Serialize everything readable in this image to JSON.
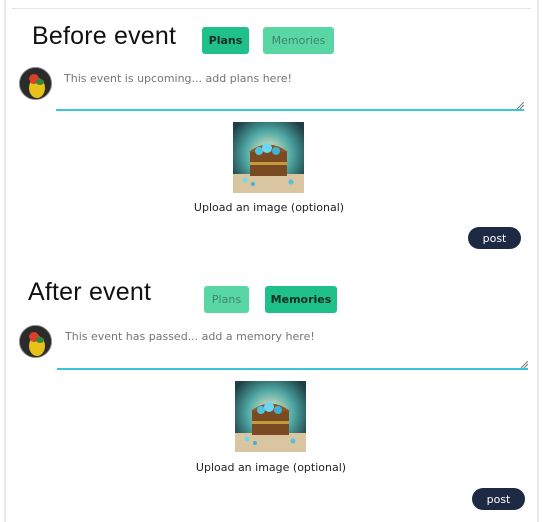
{
  "before": {
    "heading": "Before event",
    "tabs": {
      "plans": "Plans",
      "memories": "Memories",
      "active": "plans"
    },
    "placeholder": "This event is upcoming... add plans here!",
    "upload_label": "Upload an image (optional)",
    "post_label": "post"
  },
  "after": {
    "heading": "After event",
    "tabs": {
      "plans": "Plans",
      "memories": "Memories",
      "active": "memories"
    },
    "placeholder": "This event has passed... add a memory here!",
    "upload_label": "Upload an image (optional)",
    "post_label": "post"
  },
  "colors": {
    "tab_green": "#1fc08a",
    "textarea_underline": "#39c6dd",
    "post_button": "#1e2a44"
  },
  "icons": {
    "avatar": "parrot-avatar",
    "upload": "treasure-chest-image"
  }
}
